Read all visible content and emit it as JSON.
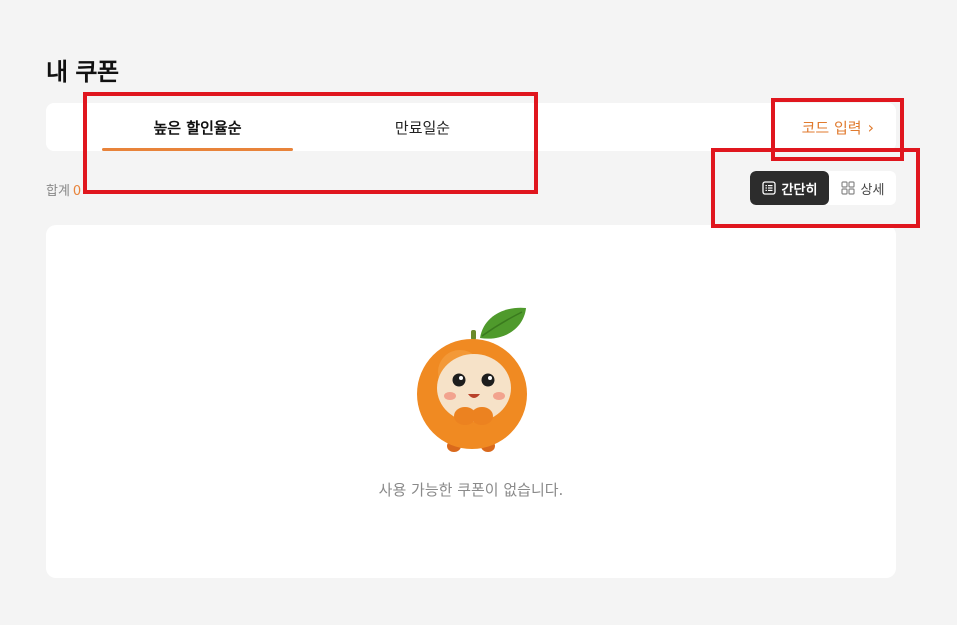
{
  "page": {
    "title": "내 쿠폰"
  },
  "tabs": [
    {
      "label": "높은 할인율순",
      "active": true
    },
    {
      "label": "만료일순",
      "active": false
    }
  ],
  "code_entry": {
    "label": "코드 입력",
    "chevron": "›"
  },
  "summary": {
    "total_label": "합계",
    "total_count": "0"
  },
  "view_toggle": {
    "simple": {
      "label": "간단히",
      "icon": "list-icon",
      "active": true
    },
    "detail": {
      "label": "상세",
      "icon": "grid-icon",
      "active": false
    }
  },
  "empty_state": {
    "mascot": "orange-mascot-illustration",
    "message": "사용 가능한 쿠폰이 없습니다."
  },
  "colors": {
    "accent": "#e8833a",
    "highlight": "#e0161e",
    "toggle_active": "#2c2c2c",
    "background": "#f4f4f4"
  }
}
